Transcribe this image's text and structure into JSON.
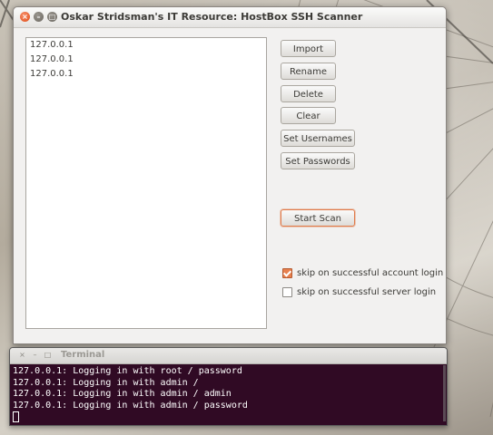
{
  "window": {
    "title": "Oskar Stridsman's IT Resource: HostBox SSH Scanner",
    "close_glyph": "×",
    "min_glyph": "–",
    "max_glyph": "□"
  },
  "hosts": [
    "127.0.0.1",
    "127.0.0.1",
    "127.0.0.1"
  ],
  "buttons": {
    "import": "Import",
    "rename": "Rename",
    "delete": "Delete",
    "clear": "Clear",
    "set_usernames": "Set Usernames",
    "set_passwords": "Set Passwords",
    "start_scan": "Start Scan"
  },
  "options": {
    "skip_account": {
      "label": "skip on successful account login",
      "checked": true
    },
    "skip_server": {
      "label": "skip on successful server login",
      "checked": false
    }
  },
  "terminal": {
    "title": "Terminal",
    "close_glyph": "×",
    "min_glyph": "–",
    "max_glyph": "□",
    "lines": [
      "127.0.0.1: Logging in with root / password",
      "127.0.0.1: Logging in with admin /",
      "127.0.0.1: Logging in with admin / admin",
      "127.0.0.1: Logging in with admin / password"
    ]
  },
  "colors": {
    "accent": "#e07a4a",
    "terminal_bg": "#300a24"
  }
}
